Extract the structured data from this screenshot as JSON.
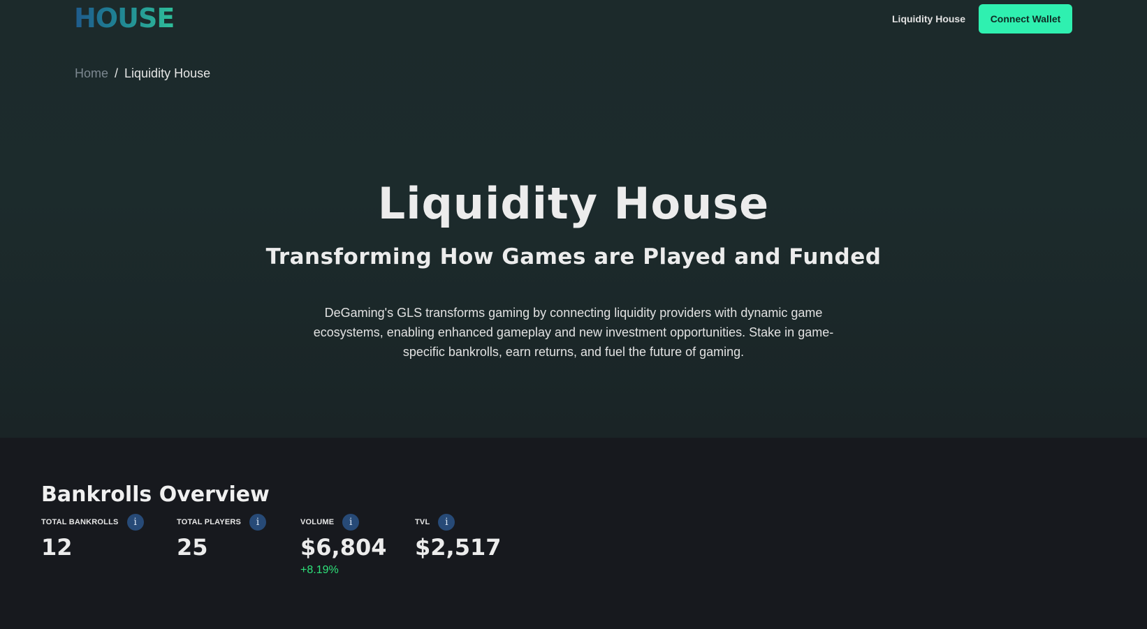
{
  "header": {
    "logo_text": "HOUSE",
    "nav_link": "Liquidity House",
    "connect_button": "Connect Wallet"
  },
  "breadcrumb": {
    "home": "Home",
    "separator": "/",
    "current": "Liquidity House"
  },
  "hero": {
    "title": "Liquidity House",
    "subtitle": "Transforming How Games are Played and Funded",
    "description": "DeGaming's GLS transforms gaming by connecting liquidity providers with dynamic game ecosystems, enabling enhanced gameplay and new investment opportunities. Stake in game-specific bankrolls, earn returns, and fuel the future of gaming."
  },
  "overview": {
    "title": "Bankrolls Overview",
    "stats": [
      {
        "label": "TOTAL BANKROLLS",
        "value": "12",
        "icon": "info-icon"
      },
      {
        "label": "TOTAL PLAYERS",
        "value": "25",
        "icon": "info-icon"
      },
      {
        "label": "VOLUME",
        "value": "$6,804",
        "change": "+8.19%",
        "icon": "info-icon"
      },
      {
        "label": "TVL",
        "value": "$2,517",
        "icon": "info-icon"
      }
    ]
  },
  "colors": {
    "accent": "#2ff0b0",
    "positive": "#2ee27a",
    "info_icon_bg": "#274a77",
    "hero_bg": "#1c2a2b",
    "page_bg": "#17191e"
  }
}
